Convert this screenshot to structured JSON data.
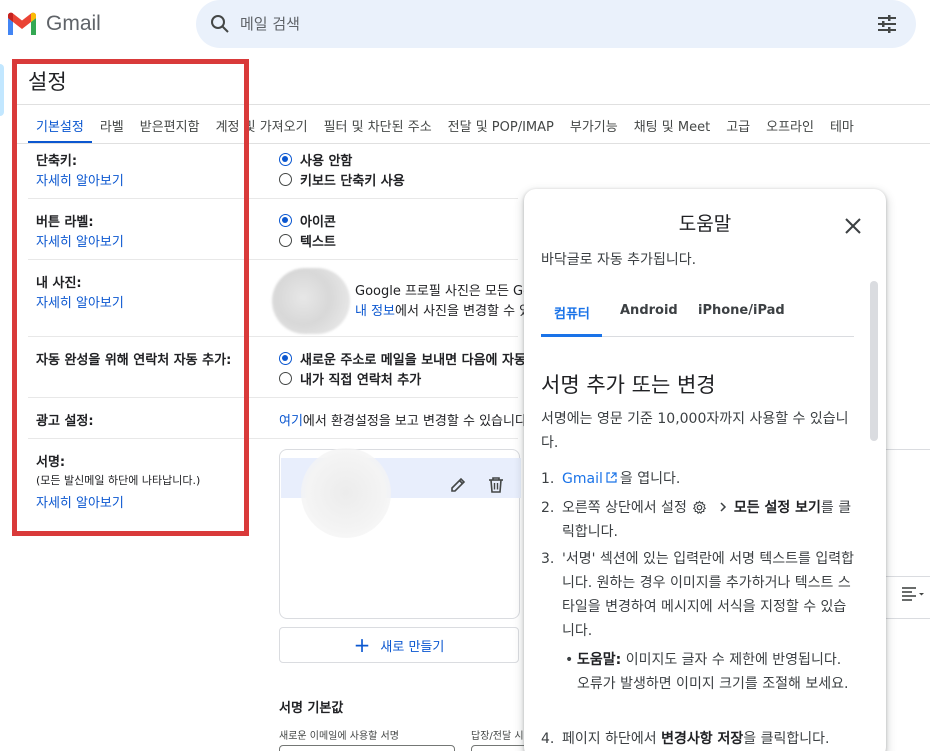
{
  "header": {
    "app_name": "Gmail",
    "search_placeholder": "메일 검색"
  },
  "settings": {
    "title": "설정",
    "tabs": [
      "기본설정",
      "라벨",
      "받은편지함",
      "계정 및 가져오기",
      "필터 및 차단된 주소",
      "전달 및 POP/IMAP",
      "부가기능",
      "채팅 및 Meet",
      "고급",
      "오프라인",
      "테마"
    ],
    "learn_more": "자세히 알아보기",
    "shortcuts": {
      "label": "단축키:",
      "options": [
        "사용 안함",
        "키보드 단축키 사용"
      ],
      "selected": "사용 안함"
    },
    "button_labels": {
      "label": "버튼 라벨:",
      "options": [
        "아이콘",
        "텍스트"
      ],
      "selected": "아이콘"
    },
    "my_picture": {
      "label": "내 사진:",
      "text": "Google 프로필 사진은 모든 Go",
      "link": "내 정보",
      "text2": "에서 사진을 변경할 수 있"
    },
    "autocomplete": {
      "label": "자동 완성을 위해 연락처 자동 추가:",
      "options": [
        "새로운 주소로 메일을 보내면 다음에 자동",
        "내가 직접 연락처 추가"
      ],
      "selected": "새로운 주소로 메일을 보내면 다음에 자동"
    },
    "ads": {
      "label": "광고 설정:",
      "link": "여기",
      "text": "에서 환경설정을 보고 변경할 수 있습니다"
    },
    "signature": {
      "label": "서명:",
      "sublabel": "(모든 발신메일 하단에 나타납니다.)",
      "new_button": "새로 만들기",
      "defaults_title": "서명 기본값",
      "new_email_label": "새로운 이메일에 사용할 서명",
      "reply_label": "답장/전달 시"
    }
  },
  "help_panel": {
    "title": "도움말",
    "intro": "바닥글로 자동 추가됩니다.",
    "tabs": [
      "컴퓨터",
      "Android",
      "iPhone/iPad"
    ],
    "active_tab": "컴퓨터",
    "heading": "서명 추가 또는 변경",
    "paragraph": "서명에는 영문 기준 10,000자까지 사용할 수 있습니다.",
    "steps": {
      "s1_num": "1.",
      "s1_link": "Gmail",
      "s1_text": "을 엽니다.",
      "s2_num": "2.",
      "s2_a": "오른쪽 상단에서 설정",
      "s2_b": "모든 설정 보기",
      "s2_c": "를 클릭합니다.",
      "s3_num": "3.",
      "s3_text": "'서명' 섹션에 있는 입력란에 서명 텍스트를 입력합니다. 원하는 경우 이미지를 추가하거나 텍스트 스타일을 변경하여 메시지에 서식을 지정할 수 있습니다.",
      "tip_label": "도움말:",
      "tip_text": " 이미지도 글자 수 제한에 반영됩니다. 오류가 발생하면 이미지 크기를 조절해 보세요.",
      "s4_num": "4.",
      "s4_a": "페이지 하단에서",
      "s4_b": "변경사항 저장",
      "s4_c": "을 클릭합니다."
    }
  },
  "colors": {
    "accent_blue": "#0b57d0",
    "highlight_red": "#d93a3a",
    "search_bg": "#eaf1fb"
  }
}
